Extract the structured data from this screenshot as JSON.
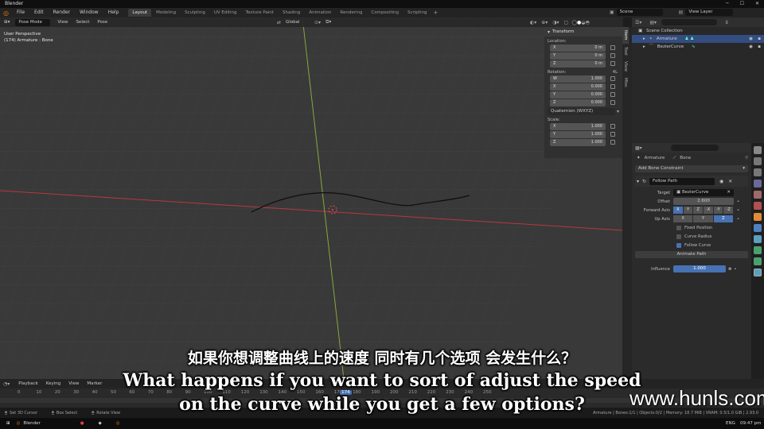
{
  "window": {
    "title": "Blender"
  },
  "menu": [
    "File",
    "Edit",
    "Render",
    "Window",
    "Help"
  ],
  "workspaces": [
    "Layout",
    "Modeling",
    "Sculpting",
    "UV Editing",
    "Texture Paint",
    "Shading",
    "Animation",
    "Rendering",
    "Compositing",
    "Scripting"
  ],
  "active_workspace": "Layout",
  "scene": {
    "label": "Scene",
    "view_layer": "View Layer"
  },
  "viewport": {
    "mode": "Pose Mode",
    "menus": [
      "View",
      "Select",
      "Pose"
    ],
    "orientation": "Global",
    "perspective": "User Perspective",
    "object_info": "(174) Armature : Bone"
  },
  "npanel": {
    "section": "Transform",
    "location_label": "Location:",
    "rotation_label": "Rotation:",
    "rotation_mode_tag": "4L",
    "scale_label": "Scale:",
    "location": [
      {
        "axis": "X",
        "value": "0 m"
      },
      {
        "axis": "Y",
        "value": "0 m"
      },
      {
        "axis": "Z",
        "value": "0 m"
      }
    ],
    "rotation": [
      {
        "axis": "W",
        "value": "1.000"
      },
      {
        "axis": "X",
        "value": "0.000"
      },
      {
        "axis": "Y",
        "value": "0.000"
      },
      {
        "axis": "Z",
        "value": "0.000"
      }
    ],
    "rotation_mode": "Quaternion (WXYZ)",
    "scale": [
      {
        "axis": "X",
        "value": "1.000"
      },
      {
        "axis": "Y",
        "value": "1.000"
      },
      {
        "axis": "Z",
        "value": "1.000"
      }
    ],
    "tabs": [
      "Item",
      "Tool",
      "View",
      "Misc"
    ]
  },
  "outliner": {
    "root": "Scene Collection",
    "items": [
      "Armature",
      "BezierCurve"
    ]
  },
  "properties": {
    "breadcrumb_object": "Armature",
    "breadcrumb_bone": "Bone",
    "add_constraint": "Add Bone Constraint",
    "constraint_name": "Follow Path",
    "target_label": "Target",
    "target_value": "BezierCurve",
    "offset_label": "Offset",
    "offset_value": "2.600",
    "forward_axis_label": "Forward Axis",
    "forward_axes": [
      "X",
      "Y",
      "Z",
      "-X",
      "-Y",
      "-Z"
    ],
    "up_axis_label": "Up Axis",
    "up_axes": [
      "X",
      "Y",
      "Z"
    ],
    "fixed_position": "Fixed Position",
    "curve_radius": "Curve Radius",
    "follow_curve": "Follow Curve",
    "animate_path": "Animate Path",
    "influence_label": "Influence",
    "influence_value": "1.000"
  },
  "timeline": {
    "menus": [
      "Playback",
      "Keying",
      "View",
      "Marker"
    ],
    "ticks": [
      "0",
      "10",
      "20",
      "30",
      "40",
      "50",
      "60",
      "70",
      "80",
      "90",
      "100",
      "110",
      "120",
      "130",
      "140",
      "150",
      "160",
      "170",
      "180",
      "190",
      "200",
      "210",
      "220",
      "230",
      "240",
      "250"
    ],
    "current_frame": "174"
  },
  "statusbar": {
    "left": [
      "Set 3D Cursor",
      "Box Select",
      "Rotate View"
    ],
    "right": "Armature | Bones:1/1 | Objects:0/2 | Memory: 18.7 MiB | VRAM: 0.5/1.0 GiB | 2.93.0"
  },
  "taskbar": {
    "app": "Blender",
    "lang": "ENG",
    "time": "09:47 pm"
  },
  "subtitles": {
    "zh": "如果你想调整曲线上的速度 同时有几个选项 会发生什么？",
    "en_line1": "What happens if you want to sort of adjust the speed",
    "en_line2": "on the curve while you get a few options?"
  },
  "watermark": "www.hunls.com",
  "colors": {
    "accent": "#4772b3",
    "x_axis": "#b8393f",
    "y_axis": "#86a83a",
    "viewport_bg": "#393939"
  }
}
